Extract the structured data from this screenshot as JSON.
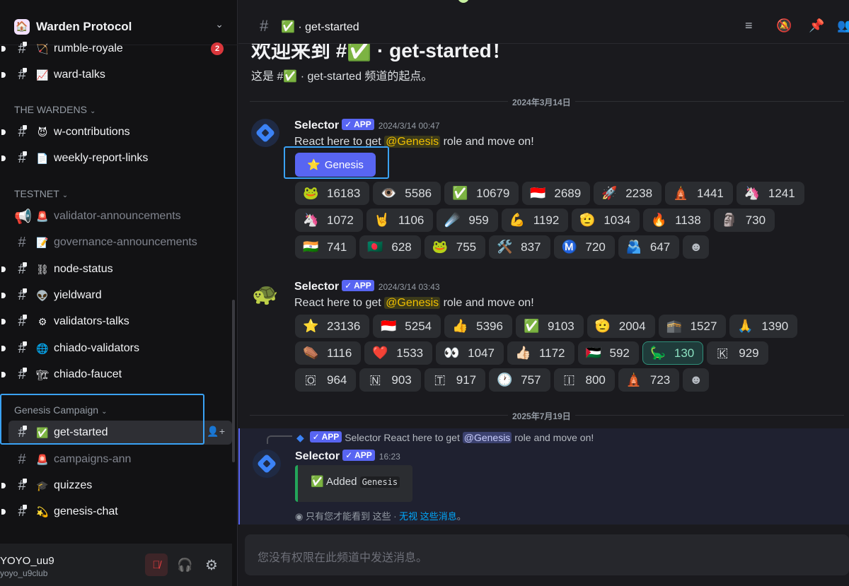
{
  "server": {
    "name": "Warden Protocol",
    "logo_icon": "🏠"
  },
  "sidebar": {
    "top_channels": [
      {
        "emoji": "🏹",
        "label": "rumble-royale",
        "badge": "2"
      },
      {
        "emoji": "📈",
        "label": "ward-talks"
      }
    ],
    "categories": {
      "wardens": "THE WARDENS",
      "testnet": "TESTNET",
      "genesis": "Genesis Campaign"
    },
    "wardens_channels": [
      {
        "emoji": "😈",
        "label": "w-contributions"
      },
      {
        "emoji": "📄",
        "label": "weekly-report-links"
      }
    ],
    "testnet_channels": [
      {
        "emoji": "🚨",
        "label": "validator-announcements"
      },
      {
        "emoji": "📝",
        "label": "governance-announcements"
      },
      {
        "emoji": "⛓",
        "label": "node-status"
      },
      {
        "emoji": "👽",
        "label": "yieldward"
      },
      {
        "emoji": "⚙",
        "label": "validators-talks"
      },
      {
        "emoji": "🌐",
        "label": "chiado-validators"
      },
      {
        "emoji": "🏗",
        "label": "chiado-faucet"
      }
    ],
    "genesis_channels": [
      {
        "emoji": "✅",
        "label": "get-started"
      },
      {
        "emoji": "🚨",
        "label": "campaigns-ann"
      },
      {
        "emoji": "🎓",
        "label": "quizzes"
      },
      {
        "emoji": "💫",
        "label": "genesis-chat"
      }
    ]
  },
  "user": {
    "name": "YOYO_uu9",
    "handle": "yoyo_u9club"
  },
  "header": {
    "channel_emoji": "✅",
    "channel_name": "get-started"
  },
  "welcome": {
    "title": "欢迎来到 #✅ · get-started！",
    "subtitle_prefix": "这是 #✅ · get-started 频道的起点。"
  },
  "dividers": {
    "first": "2024年3月14日",
    "second": "2025年7月19日"
  },
  "messages": [
    {
      "author": "Selector",
      "tag": "✓ APP",
      "time": "2024/3/14 00:47",
      "text_before": "React here to get ",
      "mention": "@Genesis",
      "text_after": " role and move on!",
      "button": {
        "icon": "⭐",
        "label": "Genesis"
      },
      "reactions": [
        {
          "e": "🐸",
          "n": "16183"
        },
        {
          "e": "👁️",
          "n": "5586"
        },
        {
          "e": "✅",
          "n": "10679"
        },
        {
          "e": "🇮🇩",
          "n": "2689"
        },
        {
          "e": "🚀",
          "n": "2238"
        },
        {
          "e": "🛕",
          "n": "1441"
        },
        {
          "e": "🦄",
          "n": "1241"
        },
        {
          "e": "🦄",
          "n": "1072"
        },
        {
          "e": "🤘",
          "n": "1106"
        },
        {
          "e": "☄️",
          "n": "959"
        },
        {
          "e": "💪",
          "n": "1192"
        },
        {
          "e": "🫡",
          "n": "1034"
        },
        {
          "e": "🔥",
          "n": "1138"
        },
        {
          "e": "🗿",
          "n": "730"
        },
        {
          "e": "🇮🇳",
          "n": "741"
        },
        {
          "e": "🇧🇩",
          "n": "628"
        },
        {
          "e": "🐸",
          "n": "755"
        },
        {
          "e": "🛠️",
          "n": "837"
        },
        {
          "e": "Ⓜ️",
          "n": "720"
        },
        {
          "e": "🫂",
          "n": "647"
        }
      ]
    },
    {
      "author": "Selector",
      "tag": "✓ APP",
      "time": "2024/3/14 03:43",
      "text_before": "React here to get ",
      "mention": "@Genesis",
      "text_after": " role and move on!",
      "reactions": [
        {
          "e": "⭐",
          "n": "23136"
        },
        {
          "e": "🇮🇩",
          "n": "5254"
        },
        {
          "e": "👍",
          "n": "5396"
        },
        {
          "e": "✅",
          "n": "9103"
        },
        {
          "e": "🫡",
          "n": "2004"
        },
        {
          "e": "🕋",
          "n": "1527"
        },
        {
          "e": "🙏",
          "n": "1390"
        },
        {
          "e": "⚰️",
          "n": "1116"
        },
        {
          "e": "❤️",
          "n": "1533"
        },
        {
          "e": "👀",
          "n": "1047"
        },
        {
          "e": "👍🏻",
          "n": "1172"
        },
        {
          "e": "🇵🇸",
          "n": "592"
        },
        {
          "e": "🦕",
          "n": "130",
          "hl": true
        },
        {
          "e": "🇰",
          "n": "929"
        },
        {
          "e": "🇴",
          "n": "964"
        },
        {
          "e": "🇳",
          "n": "903"
        },
        {
          "e": "🇹",
          "n": "917"
        },
        {
          "e": "🕐",
          "n": "757"
        },
        {
          "e": "🇮",
          "n": "800"
        },
        {
          "e": "🛕",
          "n": "723"
        }
      ]
    }
  ],
  "reply": {
    "preview": "Selector React here to get",
    "preview_tag": "✓ APP",
    "preview_mention": "@Genesis",
    "preview_after": "role and move on!",
    "author": "Selector",
    "tag": "✓ APP",
    "time": "16:23",
    "embed_text": "Added",
    "embed_code": "Genesis",
    "ephemeral_text": "只有您才能看到 这些 · ",
    "ephemeral_link": "无视 这些消息",
    "ephemeral_end": "。"
  },
  "composer": {
    "placeholder": "您没有权限在此频道中发送消息。"
  }
}
